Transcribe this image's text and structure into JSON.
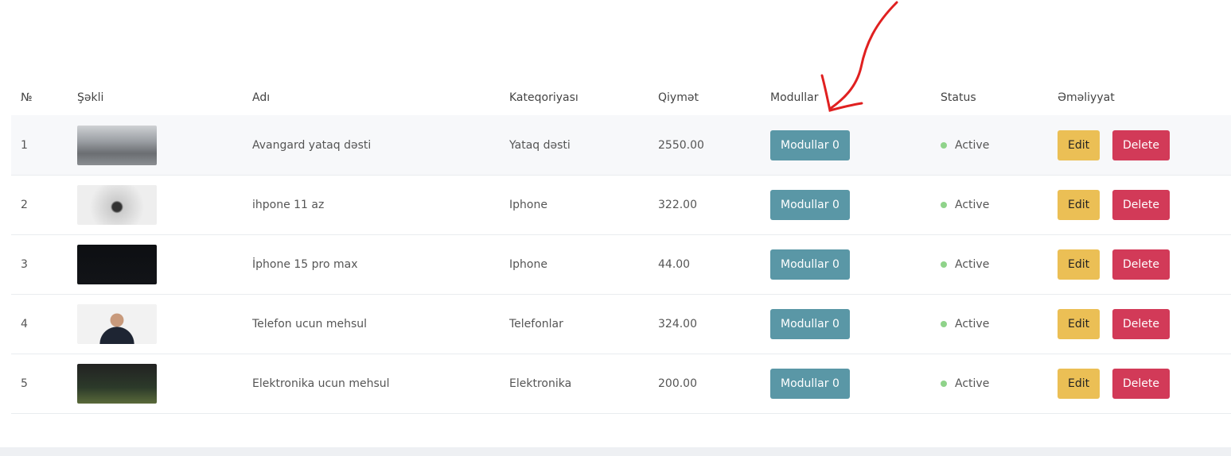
{
  "headers": [
    "№",
    "Şəkli",
    "Adı",
    "Kateqoriyası",
    "Qiymət",
    "Modullar",
    "Status",
    "Əməliyyat"
  ],
  "rows": [
    {
      "n": "1",
      "name": "Avangard yataq dəsti",
      "category": "Yataq dəsti",
      "price": "2550.00",
      "modules": "Modullar 0",
      "status": "Active",
      "image": "bedroom-photo"
    },
    {
      "n": "2",
      "name": "ihpone 11 az",
      "category": "Iphone",
      "price": "322.00",
      "modules": "Modullar 0",
      "status": "Active",
      "image": "joker-photo"
    },
    {
      "n": "3",
      "name": "İphone 15 pro max",
      "category": "Iphone",
      "price": "44.00",
      "modules": "Modullar 0",
      "status": "Active",
      "image": "code-screen-photo"
    },
    {
      "n": "4",
      "name": "Telefon ucun mehsul",
      "category": "Telefonlar",
      "price": "324.00",
      "modules": "Modullar 0",
      "status": "Active",
      "image": "man-portrait-photo"
    },
    {
      "n": "5",
      "name": "Elektronika ucun mehsul",
      "category": "Elektronika",
      "price": "200.00",
      "modules": "Modullar 0",
      "status": "Active",
      "image": "who-codes-poster"
    }
  ],
  "actions": {
    "edit": "Edit",
    "delete": "Delete"
  },
  "colors": {
    "modules_button": "#5a97a6",
    "edit_button": "#ebbf55",
    "delete_button": "#d23a58",
    "status_dot": "#8fd38a",
    "annotation_arrow": "#e02020"
  }
}
